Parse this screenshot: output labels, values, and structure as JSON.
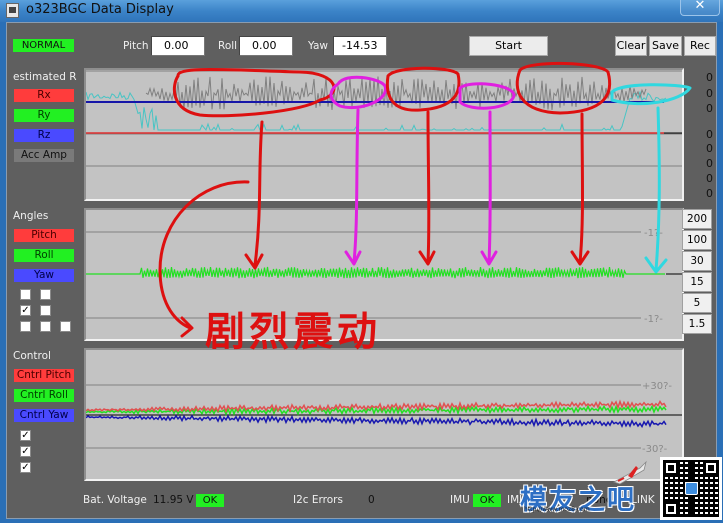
{
  "window": {
    "title": "o323BGC Data Display",
    "close_icon": "close-icon"
  },
  "toolbar": {
    "status": "NORMAL",
    "status_color": "#22f022",
    "pitch_label": "Pitch",
    "pitch_value": "0.00",
    "roll_label": "Roll",
    "roll_value": "0.00",
    "yaw_label": "Yaw",
    "yaw_value": "-14.53",
    "start_label": "Start",
    "clear_label": "Clear",
    "save_label": "Save",
    "rec_label": "Rec"
  },
  "sidebar": {
    "estimated": {
      "title": "estimated R",
      "items": [
        {
          "label": "Rx",
          "color": "#ff3c3c"
        },
        {
          "label": "Ry",
          "color": "#22f022"
        },
        {
          "label": "Rz",
          "color": "#4a4aff"
        },
        {
          "label": "Acc Amp",
          "color": "#7a7a7a"
        }
      ]
    },
    "angles": {
      "title": "Angles",
      "items": [
        {
          "label": "Pitch",
          "color": "#ff3c3c"
        },
        {
          "label": "Roll",
          "color": "#22f022"
        },
        {
          "label": "Yaw",
          "color": "#4a4aff"
        }
      ],
      "checkboxes": [
        [
          false,
          false
        ],
        [
          true,
          false
        ],
        [
          false,
          false,
          false
        ]
      ]
    },
    "control": {
      "title": "Control",
      "items": [
        {
          "label": "Cntrl Pitch",
          "color": "#ff3c3c"
        },
        {
          "label": "Cntrl Roll",
          "color": "#22f022"
        },
        {
          "label": "Cntrl Yaw",
          "color": "#4a4aff"
        }
      ],
      "checkboxes": [
        true,
        true,
        true
      ]
    }
  },
  "plot1": {
    "right_values": [
      "0",
      "0",
      "0",
      "0",
      "0",
      "0",
      "0",
      "0"
    ]
  },
  "plot2": {
    "tick_top": "-1?-",
    "tick_bottom": "-1?-",
    "scale_buttons": [
      "200",
      "100",
      "30",
      "15",
      "5",
      "1.5"
    ]
  },
  "plot3": {
    "tick_top": "+30?-",
    "tick_bottom": "-30?-"
  },
  "statusbar": {
    "bat_label": "Bat. Voltage",
    "bat_value": "11.95 V",
    "bat_status": "OK",
    "i2c_label": "I2c Errors",
    "i2c_value": "0",
    "imu_label": "IMU",
    "imu_status": "OK",
    "imu2_label": "IMU",
    "mag_label": "MAG",
    "mag_value": "none",
    "link_label": "LINK"
  },
  "annotation": {
    "handwritten_text": "剧烈震动"
  },
  "watermark": {
    "brand": "模友之吧",
    "url": "http://www.moz8.com"
  },
  "chart_data": [
    {
      "type": "line",
      "title": "estimated R",
      "series": [
        {
          "name": "Rx",
          "color": "#e03030",
          "description": "flat constant line",
          "level": 0
        },
        {
          "name": "Rz",
          "color": "#1a1ab0",
          "description": "flat constant line",
          "level": 0
        },
        {
          "name": "Acc Amp",
          "color": "#808080",
          "description": "high-amplitude noisy oscillation throughout, strongest in middle sections"
        },
        {
          "name": "Ry(cyan)",
          "color": "#40c0c0",
          "description": "noisy trace near top at start and end, dips to Rx level between"
        }
      ]
    },
    {
      "type": "line",
      "title": "Angles",
      "yticks": [
        "-1?-",
        "-1?-"
      ],
      "series": [
        {
          "name": "Roll",
          "color": "#22e022",
          "description": "flat at zero, small vibration after ~15% of the window, fading at the end"
        }
      ]
    },
    {
      "type": "line",
      "title": "Control",
      "yticks": [
        "+30?-",
        "-30?-"
      ],
      "series": [
        {
          "name": "Cntrl Pitch",
          "color": "#e05050",
          "description": "slightly above zero, rising slowly"
        },
        {
          "name": "Cntrl Roll",
          "color": "#22e022",
          "description": "just above zero with oscillation"
        },
        {
          "name": "Cntrl Yaw",
          "color": "#1a1ab0",
          "description": "slightly below zero, drifting lower"
        }
      ]
    }
  ]
}
